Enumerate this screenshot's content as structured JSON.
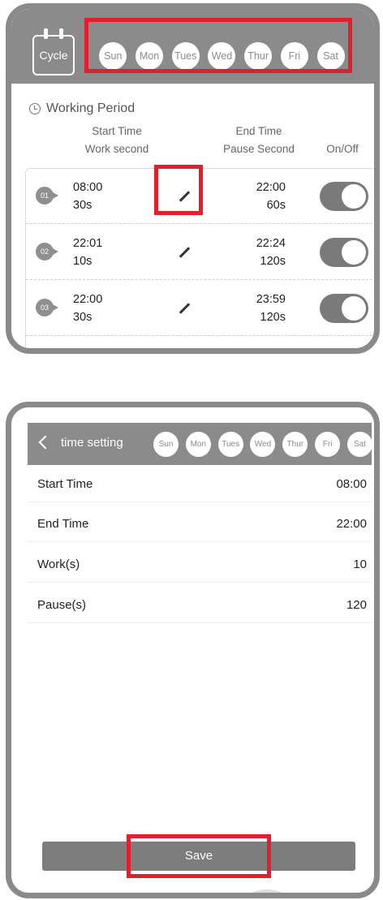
{
  "working_period": {
    "cycle_label": "Cycle",
    "days": [
      "Sun",
      "Mon",
      "Tues",
      "Wed",
      "Thur",
      "Fri",
      "Sat"
    ],
    "title": "Working Period",
    "headers": {
      "start_time": "Start Time",
      "work_second": "Work second",
      "end_time": "End Time",
      "pause_second": "Pause Second",
      "on_off": "On/Off"
    },
    "rows": [
      {
        "num": "01",
        "start": "08:00",
        "work": "30s",
        "end": "22:00",
        "pause": "60s",
        "on": true
      },
      {
        "num": "02",
        "start": "22:01",
        "work": "10s",
        "end": "22:24",
        "pause": "120s",
        "on": true
      },
      {
        "num": "03",
        "start": "22:00",
        "work": "30s",
        "end": "23:59",
        "pause": "120s",
        "on": true
      }
    ]
  },
  "time_setting": {
    "title": "time setting",
    "days": [
      "Sun",
      "Mon",
      "Tues",
      "Wed",
      "Thur",
      "Fri",
      "Sat"
    ],
    "fields": [
      {
        "label": "Start Time",
        "value": "08:00"
      },
      {
        "label": "End Time",
        "value": "22:00"
      },
      {
        "label": "Work(s)",
        "value": "10"
      },
      {
        "label": "Pause(s)",
        "value": "120"
      }
    ],
    "save_label": "Save"
  },
  "colors": {
    "header_gray": "#8b8b8b",
    "highlight_red": "#e0202f",
    "toggle_on": "#7a7a7a"
  }
}
